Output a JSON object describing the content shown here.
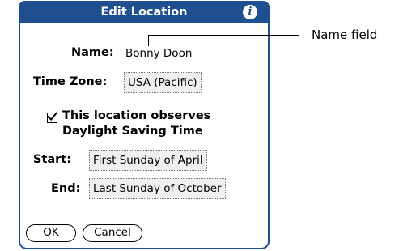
{
  "dialog": {
    "title": "Edit Location",
    "info_icon": "info-icon",
    "name_label": "Name:",
    "name_value": "Bonny Doon",
    "timezone_label": "Time Zone:",
    "timezone_value": "USA (Pacific)",
    "dst_checked": true,
    "dst_line1": "This location observes",
    "dst_line2": "Daylight Saving Time",
    "start_label": "Start:",
    "start_value": "First Sunday of April",
    "end_label": "End:",
    "end_value": "Last Sunday of October",
    "ok_label": "OK",
    "cancel_label": "Cancel"
  },
  "callout": {
    "text": "Name field"
  },
  "colors": {
    "titlebar": "#1f4f8f"
  }
}
